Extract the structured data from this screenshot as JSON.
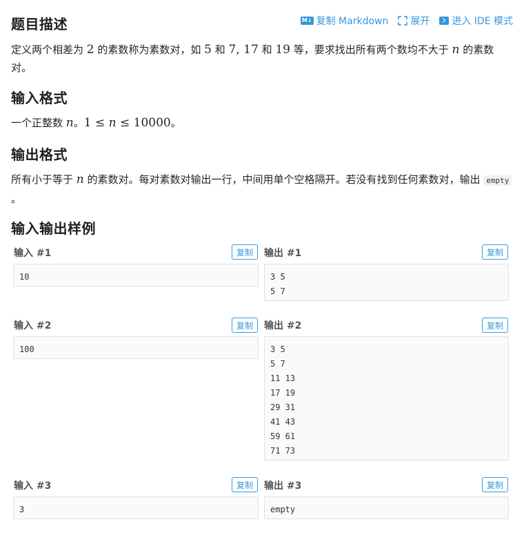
{
  "toolbar": {
    "copy_markdown": "复制 Markdown",
    "expand": "展开",
    "ide_mode": "进入 IDE 模式",
    "md_badge": "M↓",
    "accent": "#3498db"
  },
  "description": {
    "title": "题目描述",
    "text_a": "定义两个相差为 ",
    "num_2": "2",
    "text_b": " 的素数称为素数对，如 ",
    "pair1": "5",
    "text_c": " 和 ",
    "pair2": "7, 17",
    "text_d": " 和 ",
    "pair3": "19",
    "text_e": " 等，要求找出所有两个数均不大于 ",
    "var_n": "n",
    "text_f": " 的素数对。"
  },
  "input_format": {
    "title": "输入格式",
    "text_a": "一个正整数 ",
    "var_n": "n",
    "text_b": "。",
    "constraint_left": "1 ≤ ",
    "constraint_var": "n",
    "constraint_right": " ≤ 10000",
    "text_c": "。"
  },
  "output_format": {
    "title": "输出格式",
    "text_a": "所有小于等于 ",
    "var_n": "n",
    "text_b": " 的素数对。每对素数对输出一行，中间用单个空格隔开。若没有找到任何素数对，输出 ",
    "code": "empty",
    "text_c": " 。"
  },
  "samples": {
    "title": "输入输出样例",
    "copy_label": "复制",
    "items": [
      {
        "in_label": "输入 #1",
        "out_label": "输出 #1",
        "input": "10",
        "output": "3 5\n5 7"
      },
      {
        "in_label": "输入 #2",
        "out_label": "输出 #2",
        "input": "100",
        "output": "3 5\n5 7\n11 13\n17 19\n29 31\n41 43\n59 61\n71 73"
      },
      {
        "in_label": "输入 #3",
        "out_label": "输出 #3",
        "input": "3",
        "output": "empty"
      }
    ]
  }
}
